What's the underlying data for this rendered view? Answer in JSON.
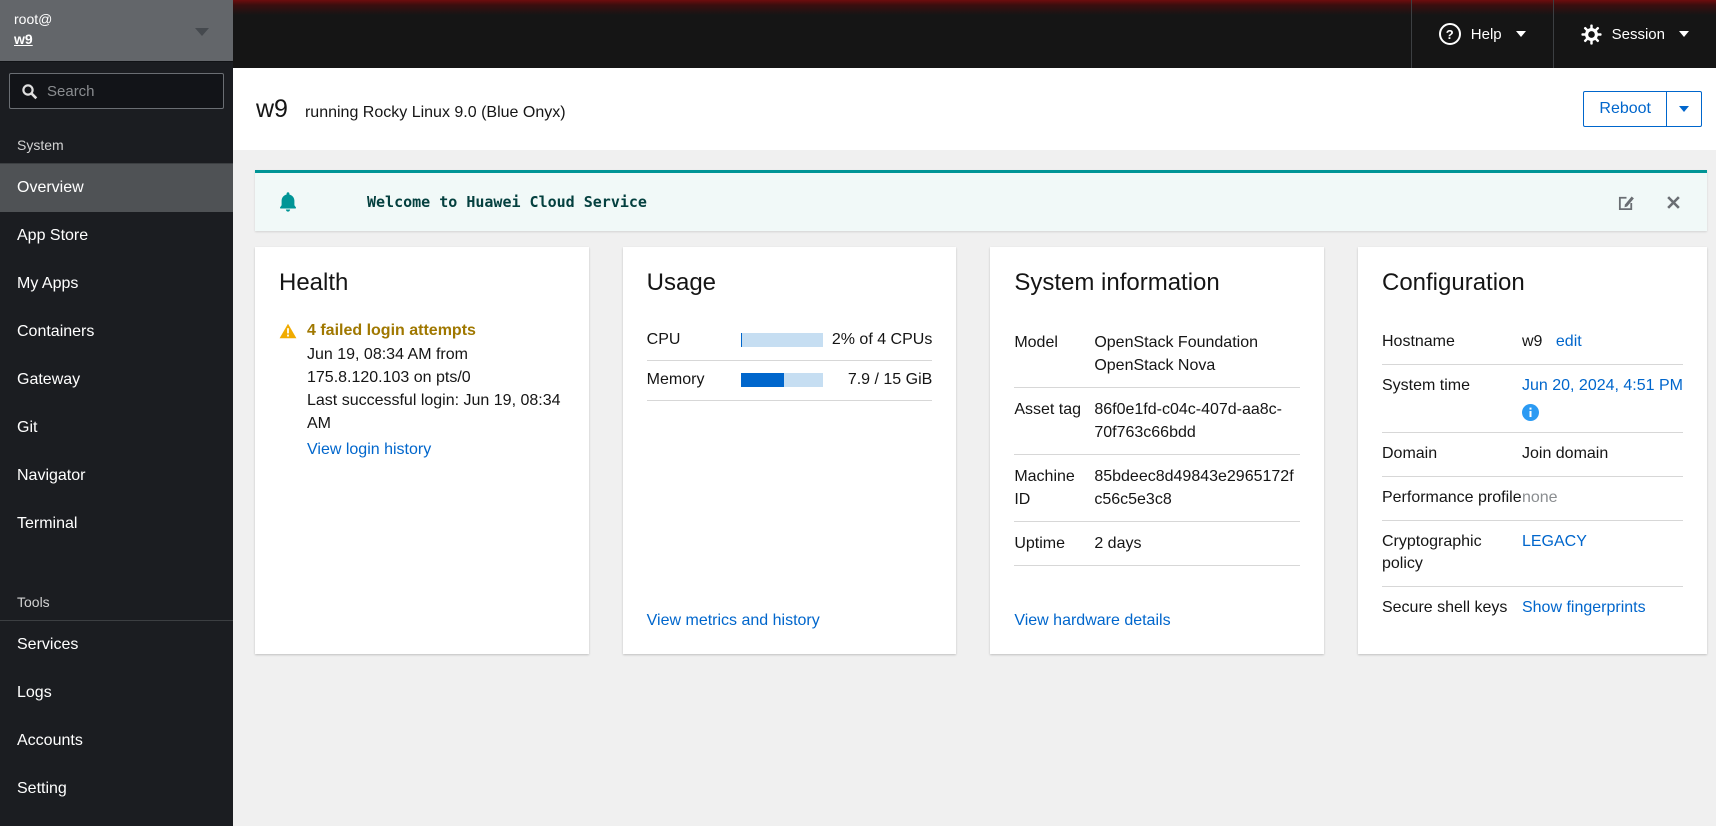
{
  "masthead": {
    "help": "Help",
    "session": "Session",
    "help_glyph": "?"
  },
  "sidebar": {
    "user_line1": "root@",
    "user_line2": "w9",
    "search_placeholder": "Search",
    "sections": [
      {
        "label": "System",
        "items": [
          {
            "label": "Overview"
          },
          {
            "label": "App Store"
          },
          {
            "label": "My Apps"
          },
          {
            "label": "Containers"
          },
          {
            "label": "Gateway"
          },
          {
            "label": "Git"
          },
          {
            "label": "Navigator"
          },
          {
            "label": "Terminal"
          }
        ]
      },
      {
        "label": "Tools",
        "items": [
          {
            "label": "Services"
          },
          {
            "label": "Logs"
          },
          {
            "label": "Accounts"
          },
          {
            "label": "Setting"
          }
        ]
      }
    ]
  },
  "header": {
    "hostname": "w9",
    "subtitle": "running Rocky Linux 9.0 (Blue Onyx)",
    "reboot": "Reboot"
  },
  "banner": {
    "title": "Welcome to Huawei Cloud Service"
  },
  "cards": {
    "health": {
      "title": "Health",
      "alert_title": "4 failed login attempts",
      "detail_1": "Jun 19, 08:34 AM from 175.8.120.103 on pts/0",
      "detail_2": "Last successful login: Jun 19, 08:34 AM",
      "link": "View login history"
    },
    "usage": {
      "title": "Usage",
      "rows": [
        {
          "label": "CPU",
          "percent": 2,
          "value": "2% of 4 CPUs"
        },
        {
          "label": "Memory",
          "percent": 53,
          "value": "7.9 / 15 GiB"
        }
      ],
      "link": "View metrics and history"
    },
    "system_information": {
      "title": "System information",
      "rows": [
        {
          "label": "Model",
          "value": "OpenStack Foundation OpenStack Nova"
        },
        {
          "label": "Asset tag",
          "value": "86f0e1fd-c04c-407d-aa8c-70f763c66bdd"
        },
        {
          "label": "Machine ID",
          "value": "85bdeec8d49843e2965172fc56c5e3c8"
        },
        {
          "label": "Uptime",
          "value": "2 days"
        }
      ],
      "link": "View hardware details"
    },
    "configuration": {
      "title": "Configuration",
      "rows": {
        "hostname": {
          "label": "Hostname",
          "value": "w9",
          "link": "edit"
        },
        "system_time": {
          "label": "System time",
          "link": "Jun 20, 2024, 4:51 PM"
        },
        "domain": {
          "label": "Domain",
          "value": "Join domain"
        },
        "performance_profile": {
          "label": "Performance profile",
          "value": "none"
        },
        "crypto_policy": {
          "label": "Cryptographic policy",
          "link": "LEGACY"
        },
        "ssh_keys": {
          "label": "Secure shell keys",
          "link": "Show fingerprints"
        }
      }
    }
  },
  "colors": {
    "accent": "#0066cc",
    "warning_icon": "#f0ab00",
    "warning_text": "#a07800",
    "banner_teal": "#009596",
    "info_icon": "#2b9af3",
    "masthead_bg": "#151515",
    "sidebar_bg": "#1b1d21"
  }
}
